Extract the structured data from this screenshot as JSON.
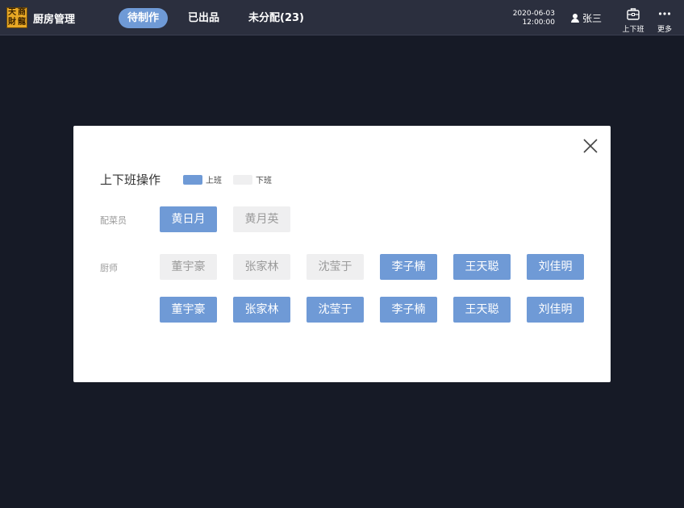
{
  "app": {
    "logo_chars": [
      "天",
      "商",
      "財",
      "龍"
    ],
    "title": "厨房管理"
  },
  "tabs": [
    {
      "label": "待制作",
      "active": true
    },
    {
      "label": "已出品",
      "active": false
    },
    {
      "label": "未分配(23)",
      "active": false
    }
  ],
  "header": {
    "date": "2020-06-03",
    "time": "12:00:00",
    "user": "张三",
    "shift_label": "上下班",
    "more_label": "更多"
  },
  "colors": {
    "on_duty": "#6f9ad6",
    "off_duty": "#efeff0",
    "topbar": "#2b2f3e",
    "background": "#161a26"
  },
  "modal": {
    "title": "上下班操作",
    "legend_on": "上班",
    "legend_off": "下班",
    "groups": [
      {
        "label": "配菜员",
        "staff": [
          {
            "name": "黄日月",
            "status": "on"
          },
          {
            "name": "黄月英",
            "status": "off"
          }
        ]
      },
      {
        "label": "厨师",
        "staff": [
          {
            "name": "董宇豪",
            "status": "off"
          },
          {
            "name": "张家林",
            "status": "off"
          },
          {
            "name": "沈莹于",
            "status": "off"
          },
          {
            "name": "李子楠",
            "status": "on"
          },
          {
            "name": "王天聪",
            "status": "on"
          },
          {
            "name": "刘佳明",
            "status": "on"
          },
          {
            "name": "董宇豪",
            "status": "on"
          },
          {
            "name": "张家林",
            "status": "on"
          },
          {
            "name": "沈莹于",
            "status": "on"
          },
          {
            "name": "李子楠",
            "status": "on"
          },
          {
            "name": "王天聪",
            "status": "on"
          },
          {
            "name": "刘佳明",
            "status": "on"
          }
        ]
      }
    ]
  }
}
